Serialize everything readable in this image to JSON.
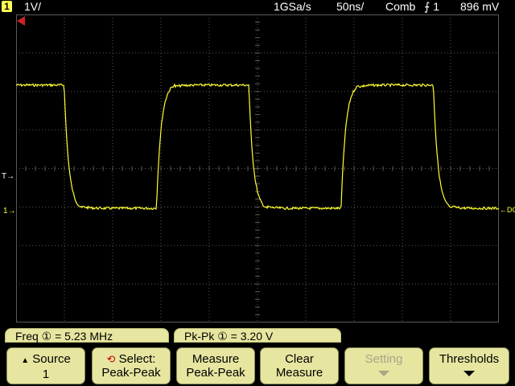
{
  "status": {
    "channel_badge": "1",
    "channel_scale": "1V/",
    "sample_rate": "1GSa/s",
    "timebase": "50ns/",
    "acq_mode": "Comb",
    "trigger": "1",
    "trigger_level": "896 mV"
  },
  "markers": {
    "ground": "1",
    "trigger_level": "T",
    "coupling": "DC"
  },
  "colors": {
    "trace": "#ffff33",
    "grid": "#5a5a5a",
    "softkey_bg": "#e6e6a0",
    "accent_red": "#cc0000"
  },
  "waveform": {
    "type": "square",
    "frequency_mhz": 5.23,
    "pk_pk_v": 3.2
  },
  "measurements": {
    "freq": "Freq ① =  5.23 MHz",
    "pkpk": "Pk-Pk ① =  3.20  V"
  },
  "softkeys": {
    "source": {
      "line1": "Source",
      "line2": "1"
    },
    "select": {
      "line1": "Select:",
      "line2": "Peak-Peak"
    },
    "measure": {
      "line1": "Measure",
      "line2": "Peak-Peak"
    },
    "clear": {
      "line1": "Clear",
      "line2": "Measure"
    },
    "setting": {
      "line1": "Setting"
    },
    "thresholds": {
      "line1": "Thresholds"
    }
  }
}
